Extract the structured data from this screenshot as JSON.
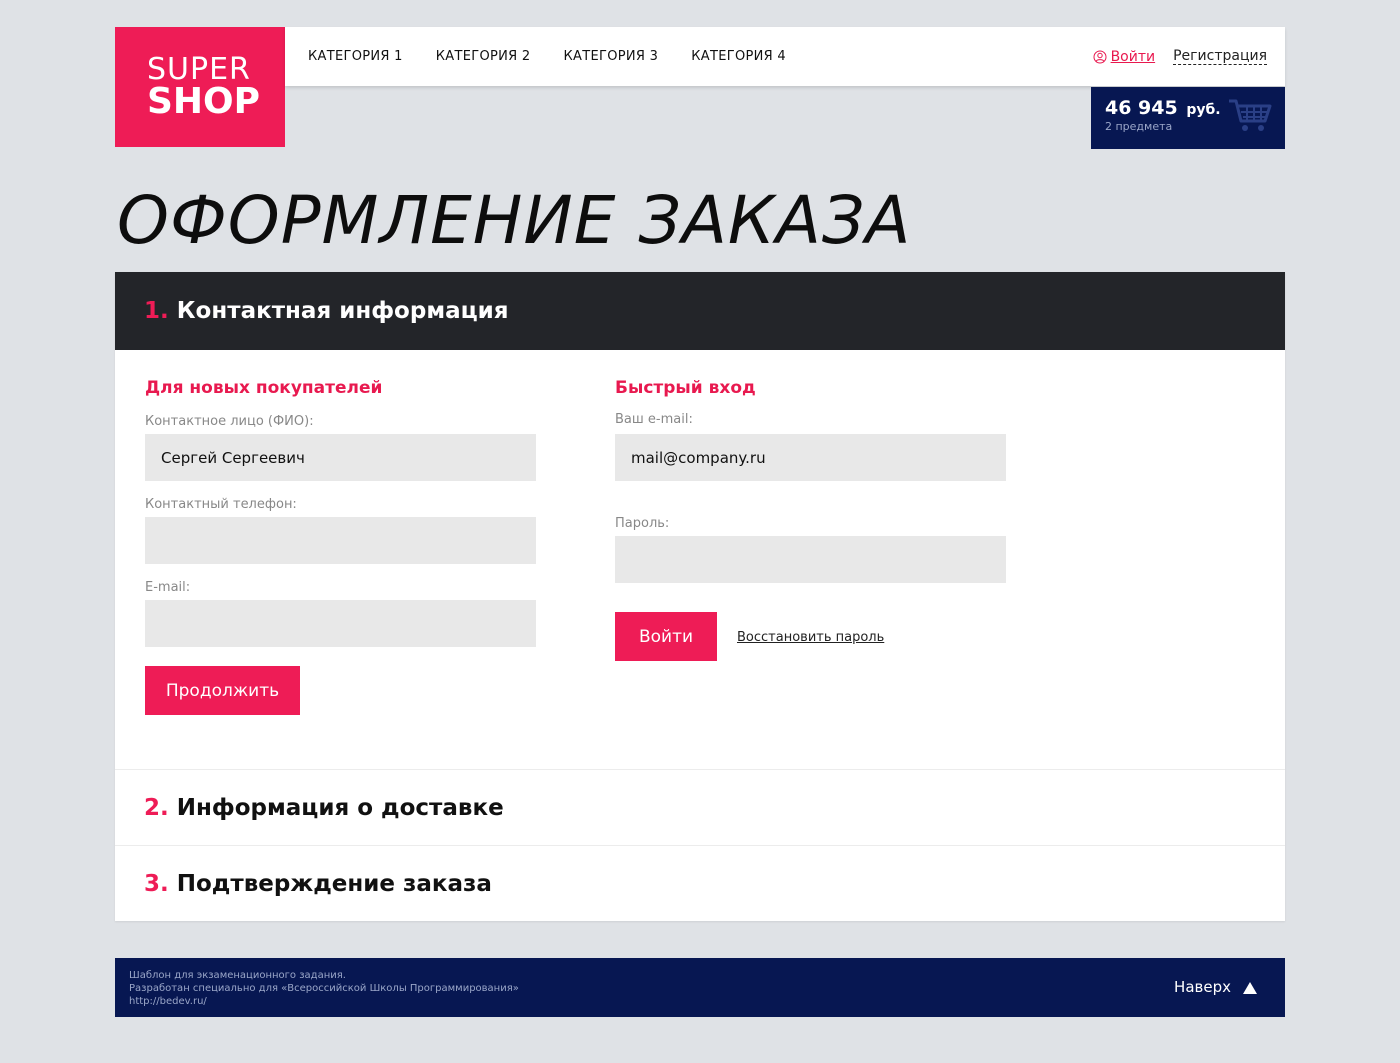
{
  "logo": {
    "line1": "SUPER",
    "line2": "SHOP"
  },
  "nav": {
    "items": [
      "КАТЕГОРИЯ 1",
      "КАТЕГОРИЯ 2",
      "КАТЕГОРИЯ 3",
      "КАТЕГОРИЯ 4"
    ]
  },
  "auth": {
    "login": "Войти",
    "register": "Регистрация"
  },
  "cart": {
    "sum": "46 945",
    "currency": "руб.",
    "count": "2 предмета",
    "icon": "cart-icon"
  },
  "page_title": "ОФОРМЛЕНИЕ ЗАКАЗА",
  "steps": [
    {
      "num": "1.",
      "title": "Контактная информация"
    },
    {
      "num": "2.",
      "title": "Информация о доставке"
    },
    {
      "num": "3.",
      "title": "Подтверждение заказа"
    }
  ],
  "new_buyers": {
    "title": "Для новых покупателей",
    "name_label": "Контактное лицо (ФИО):",
    "name_value": "Сергей Сергеевич",
    "phone_label": "Контактный телефон:",
    "phone_value": "",
    "email_label": "E-mail:",
    "email_value": "",
    "continue": "Продолжить"
  },
  "quick_login": {
    "title": "Быстрый вход",
    "email_label": "Ваш e-mail:",
    "email_value": "mail@company.ru",
    "password_label": "Пароль:",
    "password_value": "",
    "login": "Войти",
    "restore": "Восстановить пароль"
  },
  "footer": {
    "line1": "Шаблон для экзаменационного задания.",
    "line2": "Разработан специально для «Всероссийской Школы Программирования»",
    "line3": "http://bedev.ru/",
    "up": "Наверх"
  },
  "colors": {
    "accent": "#ee1c56",
    "navy": "#071752",
    "dark": "#232529",
    "bg": "#dfe2e6"
  }
}
